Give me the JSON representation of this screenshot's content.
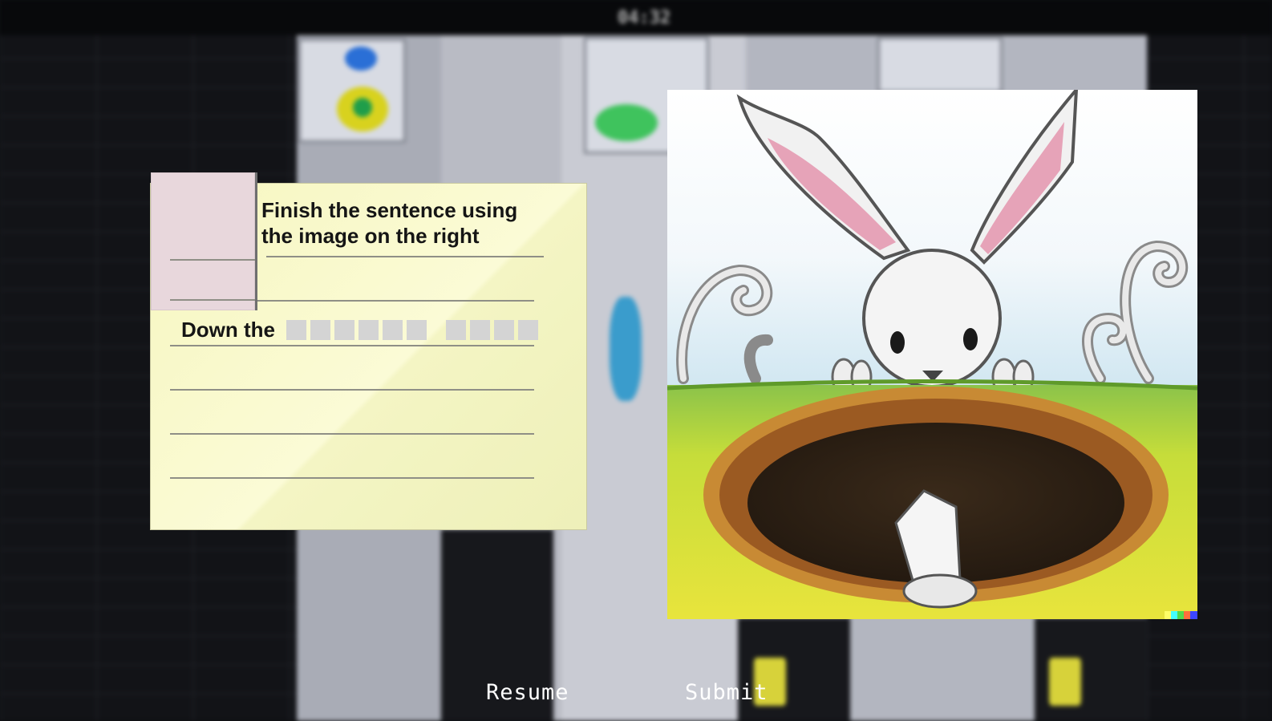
{
  "hud": {
    "timer": "04:32"
  },
  "puzzle": {
    "instruction": "Finish the sentence using\nthe image on the right",
    "sentence_prefix": "Down the",
    "answer_words": [
      {
        "letters": 6
      },
      {
        "letters": 4
      }
    ]
  },
  "buttons": {
    "resume": "Resume",
    "submit": "Submit"
  },
  "colors": {
    "note_background": "#f6f6bf",
    "note_tab": "#e8d7dc",
    "letter_box": "#d4d4d4",
    "button_text": "#ffffff"
  }
}
